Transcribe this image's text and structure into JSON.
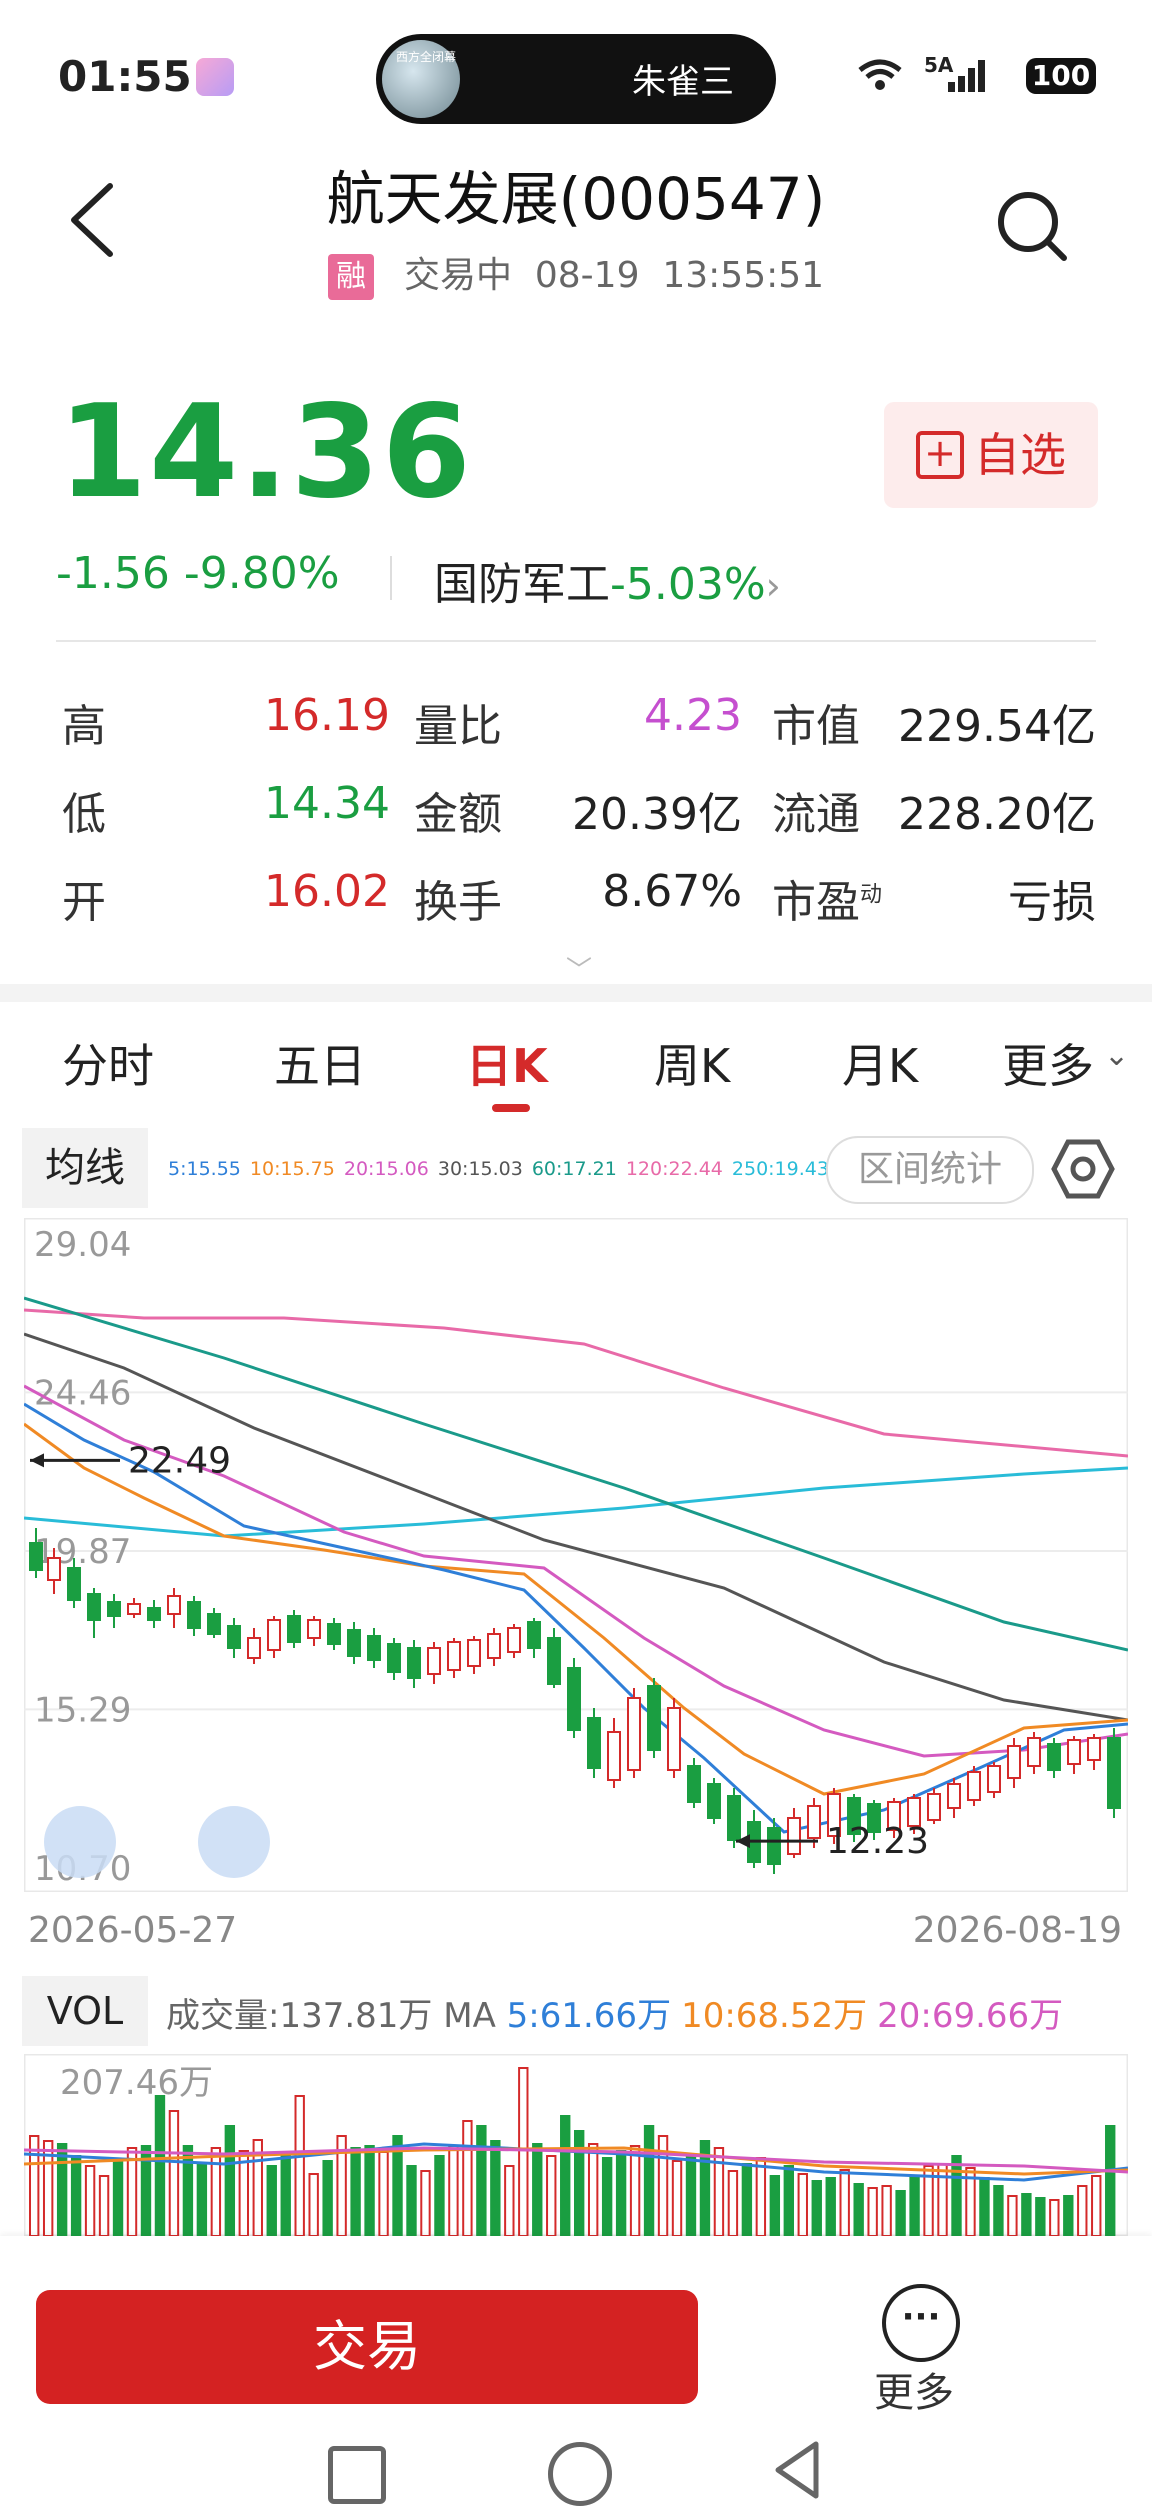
{
  "status_bar": {
    "time": "01:55",
    "island_thumb_text": "西方全闭幕",
    "island_text": "朱雀三",
    "network": "5A",
    "battery": "100"
  },
  "header": {
    "title": "航天发展(000547)",
    "badge": "融",
    "status": "交易中",
    "date": "08-19",
    "time": "13:55:51"
  },
  "price": {
    "last": "14.36",
    "change": "-1.56",
    "change_pct": "-9.80%",
    "sector_name": "国防军工",
    "sector_pct": "-5.03%",
    "watch_label": "自选",
    "color_down": "#1a9e41",
    "color_up": "#d42a2a"
  },
  "quotes": [
    [
      {
        "l": "高",
        "v": "16.19",
        "c": "red"
      },
      {
        "l": "量比",
        "v": "4.23",
        "c": "pink"
      },
      {
        "l": "市值",
        "v": "229.54亿",
        "c": ""
      }
    ],
    [
      {
        "l": "低",
        "v": "14.34",
        "c": "green"
      },
      {
        "l": "金额",
        "v": "20.39亿",
        "c": ""
      },
      {
        "l": "流通",
        "v": "228.20亿",
        "c": ""
      }
    ],
    [
      {
        "l": "开",
        "v": "16.02",
        "c": "red"
      },
      {
        "l": "换手",
        "v": "8.67%",
        "c": ""
      },
      {
        "l": "市盈",
        "v": "亏损",
        "c": ""
      }
    ]
  ],
  "pe_sup": "动",
  "tabs": [
    "分时",
    "五日",
    "日K",
    "周K",
    "月K",
    "更多"
  ],
  "active_tab": "日K",
  "ma": {
    "label": "均线",
    "values": [
      {
        "t": "5:15.55",
        "color": "#2f7fd8"
      },
      {
        "t": "10:15.75",
        "color": "#f08a24"
      },
      {
        "t": "20:15.06",
        "color": "#d45ac0"
      },
      {
        "t": "30:15.03",
        "color": "#555555"
      },
      {
        "t": "60:17.21",
        "color": "#1a9a8a"
      },
      {
        "t": "120:22.44",
        "color": "#e86aa8"
      },
      {
        "t": "250:19.43",
        "color": "#29bcd8"
      }
    ],
    "range_button": "区间统计"
  },
  "chart_data": {
    "type": "candlestick",
    "y_ticks": [
      "29.04",
      "24.46",
      "19.87",
      "15.29",
      "10.70"
    ],
    "ylim": [
      10.7,
      29.04
    ],
    "x_start": "2026-05-27",
    "x_end": "2026-08-19",
    "annotations": [
      {
        "text": "22.49",
        "value": 22.49
      },
      {
        "text": "12.23",
        "value": 12.23
      }
    ]
  },
  "volume": {
    "label": "VOL",
    "total_text": "成交量:137.81万",
    "ma_label": "MA",
    "ma": [
      {
        "t": "5:61.66万",
        "color": "#2f7fd8"
      },
      {
        "t": "10:68.52万",
        "color": "#f08a24"
      },
      {
        "t": "20:69.66万",
        "color": "#d45ac0"
      }
    ],
    "max_label": "207.46万"
  },
  "footer": {
    "trade": "交易",
    "more": "更多"
  }
}
